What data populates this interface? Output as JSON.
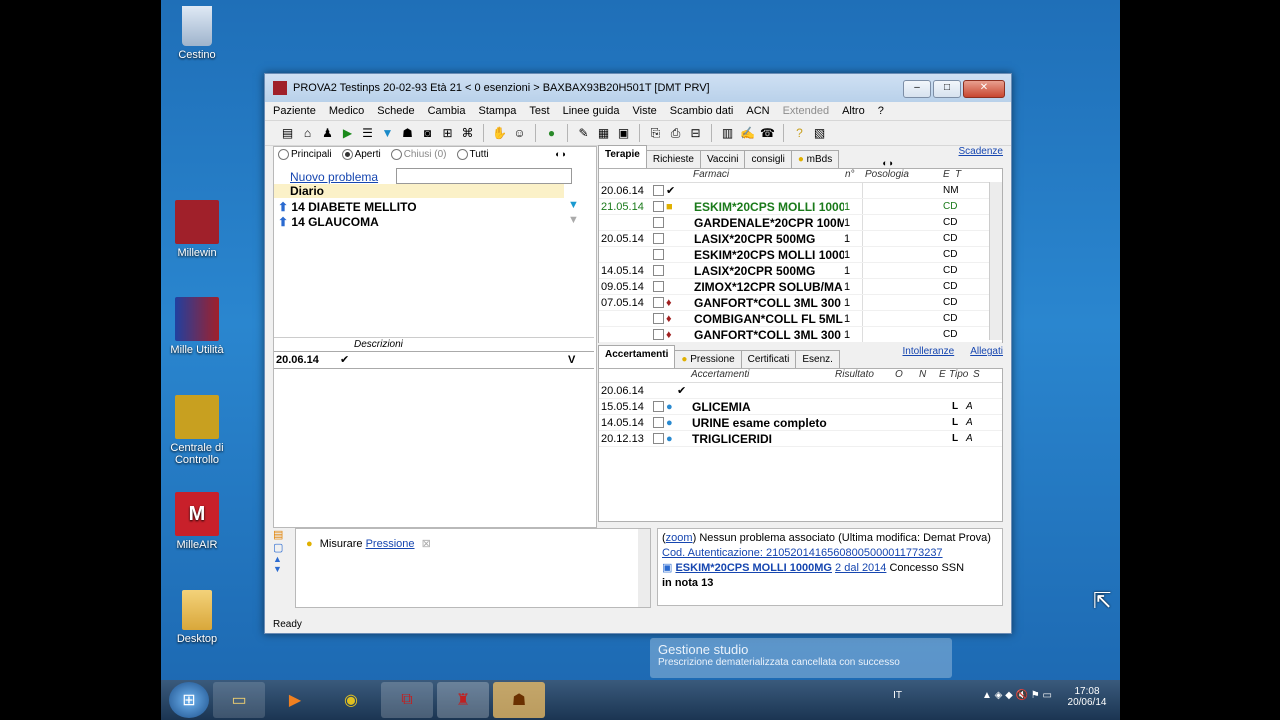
{
  "desktop": {
    "icons": [
      {
        "label": "Cestino"
      },
      {
        "label": "Millewin"
      },
      {
        "label": "Mille Utilità"
      },
      {
        "label": "Centrale di Controllo"
      },
      {
        "label": "MilleAIR"
      },
      {
        "label": "Desktop"
      }
    ]
  },
  "window": {
    "title": "PROVA2 Testinps  20-02-93  Età 21  < 0 esenzioni >  BAXBAX93B20H501T  [DMT PRV]"
  },
  "menu": [
    "Paziente",
    "Medico",
    "Schede",
    "Cambia",
    "Stampa",
    "Test",
    "Linee guida",
    "Viste",
    "Scambio dati",
    "ACN",
    "Extended",
    "Altro",
    "?"
  ],
  "left": {
    "radios": {
      "principali": "Principali",
      "aperti": "Aperti",
      "chiusi": "Chiusi (0)",
      "tutti": "Tutti"
    },
    "new_problem": "Nuovo problema",
    "diary": "Diario",
    "problems": [
      "14 DIABETE MELLITO",
      "14 GLAUCOMA"
    ],
    "desc_header": "Descrizioni",
    "diary_row": {
      "date": "20.06.14",
      "v": "V"
    }
  },
  "terapie": {
    "tabs": [
      "Terapie",
      "Richieste",
      "Vaccini",
      "consigli",
      "mBds"
    ],
    "scadenze": "Scadenze",
    "headers": {
      "farmaci": "Farmaci",
      "n": "n°",
      "posologia": "Posologia",
      "e": "E",
      "t": "T"
    },
    "rows": [
      {
        "date": "20.06.14",
        "name": "",
        "n": "",
        "e": "NM"
      },
      {
        "date": "21.05.14",
        "name": "ESKIM*20CPS MOLLI 1000",
        "n": "1",
        "e": "CD"
      },
      {
        "date": "",
        "name": "GARDENALE*20CPR 100MG",
        "n": "1",
        "e": "CD"
      },
      {
        "date": "20.05.14",
        "name": "LASIX*20CPR 500MG",
        "n": "1",
        "e": "CD"
      },
      {
        "date": "",
        "name": "ESKIM*20CPS MOLLI 1000",
        "n": "1",
        "e": "CD"
      },
      {
        "date": "14.05.14",
        "name": "LASIX*20CPR 500MG",
        "n": "1",
        "e": "CD"
      },
      {
        "date": "09.05.14",
        "name": "ZIMOX*12CPR SOLUB/MA",
        "n": "1",
        "e": "CD"
      },
      {
        "date": "07.05.14",
        "name": "GANFORT*COLL 3ML 300",
        "n": "1",
        "e": "CD"
      },
      {
        "date": "",
        "name": "COMBIGAN*COLL FL 5ML",
        "n": "1",
        "e": "CD"
      },
      {
        "date": "",
        "name": "GANFORT*COLL 3ML 300",
        "n": "1",
        "e": "CD"
      }
    ]
  },
  "accertamenti": {
    "tabs": [
      "Accertamenti",
      "Pressione",
      "Certificati",
      "Esenz."
    ],
    "intolleranze": "Intolleranze",
    "allegati": "Allegati",
    "headers": {
      "acc": "Accertamenti",
      "ris": "Risultato",
      "o": "O",
      "n": "N",
      "e": "E",
      "tipo": "Tipo",
      "s": "S"
    },
    "rows": [
      {
        "date": "20.06.14",
        "name": "",
        "tipo": "",
        "s": ""
      },
      {
        "date": "15.05.14",
        "name": "GLICEMIA",
        "tipo": "L",
        "s": "A"
      },
      {
        "date": "14.05.14",
        "name": "URINE esame completo",
        "tipo": "L",
        "s": "A"
      },
      {
        "date": "20.12.13",
        "name": "TRIGLICERIDI",
        "tipo": "L",
        "s": "A"
      }
    ]
  },
  "reminders": {
    "text": "Misurare",
    "link": "Pressione"
  },
  "notes": {
    "zoom": "zoom",
    "line1": "Nessun problema associato (Ultima modifica: Demat Prova)",
    "auth": "Cod. Autenticazione: 21052014165608005000011773237",
    "drug": "ESKIM*20CPS MOLLI 1000MG",
    "drug_qty": "2 dal 2014",
    "drug_tail": "Concesso SSN",
    "nota": "in nota 13"
  },
  "status": "Ready",
  "toast": {
    "title": "Gestione studio",
    "body": "Prescrizione dematerializzata cancellata con successo"
  },
  "tray": {
    "lang": "IT",
    "time": "17:08",
    "date": "20/06/14"
  },
  "colors": {
    "accent": "#1646b0",
    "brand": "#a0202a",
    "green": "#1a7a1a"
  }
}
